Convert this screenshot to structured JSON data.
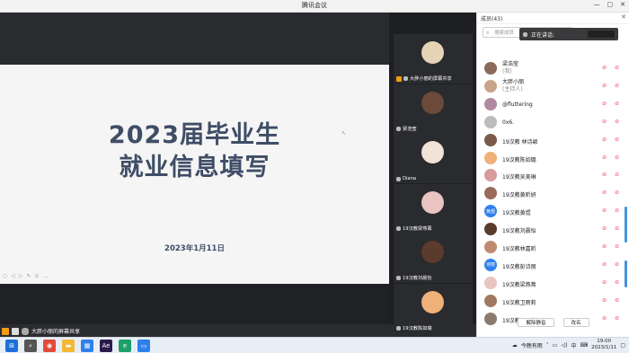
{
  "window": {
    "title": "腾讯会议",
    "controls": [
      "—",
      "▢",
      "✕"
    ]
  },
  "slide": {
    "title_line1": "2023届毕业生",
    "title_line2": "就业信息填写",
    "date": "2023年1月11日",
    "tools": [
      "○",
      "◁",
      "▷",
      "✎",
      "⊙",
      "…"
    ]
  },
  "share_bar": {
    "label": "大胖小丽的屏幕共享"
  },
  "videos": [
    {
      "label": "大胖小丽的屏幕共享",
      "avatar_color": "#e6d3b5",
      "has_share_icon": true
    },
    {
      "label": "梁浩莹",
      "avatar_color": "#6b4a3a"
    },
    {
      "label": "Diana",
      "avatar_color": "#f2e3d6"
    },
    {
      "label": "19汉教梁燕菁",
      "avatar_color": "#e9c4c0"
    },
    {
      "label": "19汉教刘晨怡",
      "avatar_color": "#5a3b2e"
    },
    {
      "label": "19汉教陈如璐",
      "avatar_color": "#f0b07a"
    }
  ],
  "panel": {
    "title": "成员(43)",
    "close": "✕",
    "search_placeholder": "搜索成员",
    "speaking": "正在讲话:"
  },
  "members": [
    {
      "name": "梁浩莹",
      "sub": "(我)",
      "color": "#8a6a5a"
    },
    {
      "name": "大胖小丽",
      "sub": "(主持人)",
      "color": "#c9a48a"
    },
    {
      "name": "@fluttering",
      "color": "#b08aa0"
    },
    {
      "name": "0x6.",
      "color": "#bcbcbc"
    },
    {
      "name": "19汉教 林诗颖",
      "color": "#7a5a4a"
    },
    {
      "name": "19汉教陈如璐",
      "color": "#f0b07a"
    },
    {
      "name": "19汉教吴美琳",
      "color": "#d89a9a"
    },
    {
      "name": "19汉教黄昕妍",
      "color": "#9a6a5a"
    },
    {
      "name": "19汉教黄煜",
      "color": "#2f80ed",
      "text": "黄煜"
    },
    {
      "name": "19汉教刘晨怡",
      "color": "#5a3b2e"
    },
    {
      "name": "19汉教林嘉昕",
      "color": "#c08a70"
    },
    {
      "name": "19汉教彭诗丽",
      "color": "#2f80ed",
      "text": "诗丽"
    },
    {
      "name": "19汉教梁燕菁",
      "color": "#e9c4c0"
    },
    {
      "name": "19汉教卫雨莉",
      "color": "#a07a60"
    },
    {
      "name": "19汉教邓亚森",
      "color": "#8a7a70"
    }
  ],
  "panel_buttons": {
    "unmute": "解除静音",
    "rename": "改名"
  },
  "taskbar": {
    "apps": [
      {
        "name": "start",
        "color": "#1e6fd9",
        "glyph": "⊞"
      },
      {
        "name": "search",
        "color": "#555",
        "glyph": "⌕"
      },
      {
        "name": "chrome",
        "color": "#e04a3a",
        "glyph": "◉"
      },
      {
        "name": "explorer",
        "color": "#f2b733",
        "glyph": "▬"
      },
      {
        "name": "store",
        "color": "#2f80ed",
        "glyph": "▦"
      },
      {
        "name": "premiere",
        "color": "#2a1a4a",
        "glyph": "Ae"
      },
      {
        "name": "edge",
        "color": "#1e9e6a",
        "glyph": "e"
      },
      {
        "name": "meeting",
        "color": "#2f80ed",
        "glyph": "▭"
      }
    ],
    "weather": "今晚有雨",
    "ime": "中",
    "time": "19:00",
    "date": "2023/1/11"
  }
}
